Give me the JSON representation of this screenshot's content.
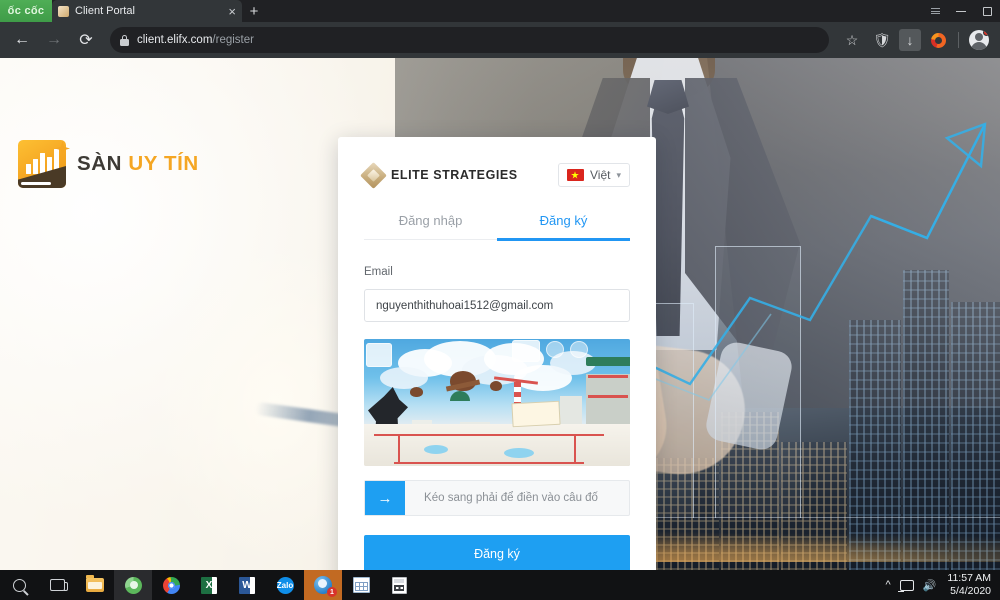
{
  "browser": {
    "coccoc_tab_label": "ốc cốc",
    "tab_title": "Client Portal",
    "tab_close_icon": "close-icon",
    "new_tab_icon": "plus-icon",
    "window_controls": {
      "list_icon": "list-icon",
      "minimize_icon": "minimize-icon",
      "maximize_icon": "maximize-icon"
    },
    "nav": {
      "back_icon": "arrow-left-icon",
      "forward_icon": "arrow-right-icon",
      "reload_icon": "reload-icon"
    },
    "omnibox": {
      "lock_icon": "lock-icon",
      "url_domain": "client.elifx.com",
      "url_path": "/register"
    },
    "toolbar_icons": {
      "bookmark": "★",
      "shield": "shield-icon",
      "download": "download-icon",
      "extension": "extension-icon",
      "profile": "avatar-icon"
    }
  },
  "brand": {
    "name_part1": "SÀN",
    "name_part2": "UY TÍN",
    "mark_icon": "bar-chart-logo-icon",
    "color_orange": "#f5a623",
    "color_dark": "#3d3a35"
  },
  "card": {
    "logo_text": "ELITE STRATEGIES",
    "logo_icon": "diamond-icon",
    "language": {
      "label": "Việt",
      "flag_icon": "vietnam-flag-icon",
      "chevron_icon": "chevron-down-icon"
    },
    "tabs": [
      {
        "label": "Đăng nhập",
        "active": false
      },
      {
        "label": "Đăng ký",
        "active": true
      }
    ],
    "email": {
      "label": "Email",
      "value": "nguyenthithuhoai1512@gmail.com",
      "placeholder": "Email"
    },
    "captcha": {
      "image_alt": "jigsaw-puzzle-captcha-cityscape"
    },
    "slider": {
      "handle_icon": "arrow-right-icon",
      "text": "Kéo sang phải để điền vào câu đố"
    },
    "submit_label": "Đăng ký",
    "accent_color": "#1e9ff2"
  },
  "taskbar": {
    "items": [
      {
        "name": "search-icon",
        "label": ""
      },
      {
        "name": "task-view-icon",
        "label": ""
      },
      {
        "name": "file-explorer-icon",
        "label": ""
      },
      {
        "name": "coccoc-browser-icon",
        "label": ""
      },
      {
        "name": "chrome-icon",
        "label": ""
      },
      {
        "name": "excel-icon",
        "label": "X"
      },
      {
        "name": "word-icon",
        "label": "W"
      },
      {
        "name": "zalo-icon",
        "label": "Zalo"
      },
      {
        "name": "coccoc-active-icon",
        "label": "",
        "badge": "1"
      },
      {
        "name": "calendar-icon",
        "label": ""
      },
      {
        "name": "calculator-icon",
        "label": ""
      }
    ],
    "tray": {
      "chevron_icon": "chevron-up-icon",
      "display_icon": "display-icon",
      "volume_icon": "volume-icon",
      "time": "11:57 AM",
      "date": "5/4/2020"
    }
  }
}
